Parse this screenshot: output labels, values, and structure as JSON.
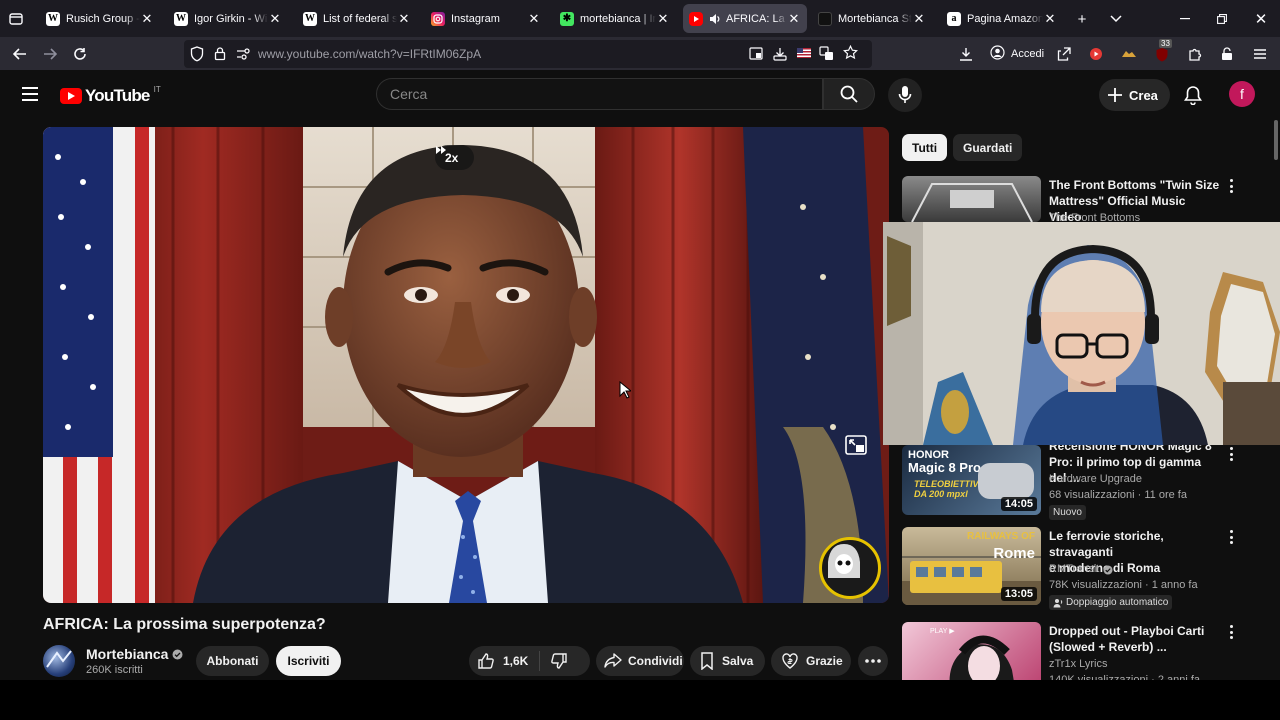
{
  "browser": {
    "tabs": [
      {
        "label": "Rusich Group - Wi",
        "favicon": "wikipedia-icon",
        "active": false
      },
      {
        "label": "Igor Girkin - Wikip",
        "favicon": "wikipedia-icon",
        "active": false
      },
      {
        "label": "List of federal subj",
        "favicon": "wikipedia-icon",
        "active": false
      },
      {
        "label": "Instagram",
        "favicon": "instagram-icon",
        "active": false
      },
      {
        "label": "mortebianca | Inst",
        "favicon": "linktree-icon",
        "active": false
      },
      {
        "label": "AFRICA: La pr",
        "favicon": "youtube-icon",
        "active": true
      },
      {
        "label": "Mortebianca Store",
        "favicon": "store-icon",
        "active": false
      },
      {
        "label": "Pagina Amazon di",
        "favicon": "amazon-icon",
        "active": false
      }
    ],
    "url": "www.youtube.com/watch?v=IFRtIM06ZpA",
    "accedi_label": "Accedi",
    "extension_badge": "33"
  },
  "youtube": {
    "logo_text": "YouTube",
    "country_code": "IT",
    "search_placeholder": "Cerca",
    "crea_label": "Crea",
    "avatar_letter": "f"
  },
  "video": {
    "speed_label": "2x",
    "title": "AFRICA: La prossima superpotenza?",
    "channel_name": "Mortebianca",
    "subscribers": "260K iscritti",
    "abbonati_label": "Abbonati",
    "iscriviti_label": "Iscriviti",
    "likes": "1,6K",
    "share_label": "Condividi",
    "save_label": "Salva",
    "thanks_label": "Grazie"
  },
  "sidebar": {
    "chips": [
      "Tutti",
      "Guardati"
    ],
    "videos": [
      {
        "title_line1": "The Front Bottoms  \"Twin Size",
        "title_line2": "Mattress\" Official Music Video",
        "channel": "The Front Bottoms"
      },
      {
        "title_line1": "Recensione HONOR Magic 8",
        "title_line2": "Pro: il primo top di gamma del ...",
        "channel": "Hardware Upgrade",
        "meta": "68 visualizzazioni · 11 ore fa",
        "badge": "Nuovo",
        "duration": "14:05",
        "thumb_text1": "HONOR",
        "thumb_text2": "Magic 8 Pro",
        "thumb_text3": "TELEOBIETTIVO",
        "thumb_text4": "DA 200 mpxl"
      },
      {
        "title_line1": "Le ferrovie storiche, stravaganti",
        "title_line2": "e moderne di Roma",
        "channel": "RMTransit",
        "meta": "78K visualizzazioni · 1 anno fa",
        "badge": "Doppiaggio automatico",
        "duration": "13:05",
        "thumb_text1": "RAILWAYS OF",
        "thumb_text2": "Rome"
      },
      {
        "title_line1": "Dropped out - Playboi Carti",
        "title_line2": "(Slowed + Reverb) ...",
        "channel": "zTr1x Lyrics",
        "meta": "140K visualizzazioni · 2 anni fa",
        "thumb_text1": "PLAY ▶"
      }
    ]
  },
  "colors": {
    "yt_red": "#ff0000",
    "bg": "#0f0f0f",
    "avatar": "#c2185b",
    "watermark_ring": "#e6c200"
  }
}
